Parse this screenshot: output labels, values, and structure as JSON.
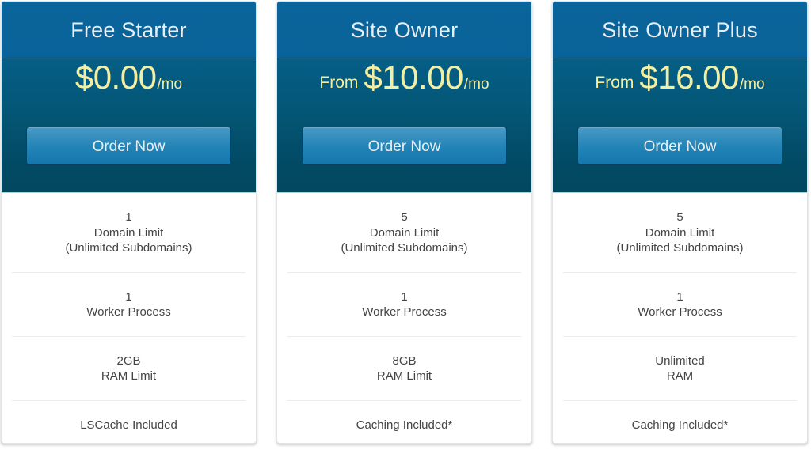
{
  "plans": [
    {
      "name": "Free Starter",
      "price_prefix": "",
      "price_amount": "$0.00",
      "price_period": "/mo",
      "cta_label": "Order Now",
      "features": [
        [
          "1",
          "Domain Limit",
          "(Unlimited Subdomains)"
        ],
        [
          "1",
          "Worker Process"
        ],
        [
          "2GB",
          "RAM Limit"
        ],
        [
          "LSCache Included"
        ]
      ]
    },
    {
      "name": "Site Owner",
      "price_prefix": "From",
      "price_amount": "$10.00",
      "price_period": "/mo",
      "cta_label": "Order Now",
      "features": [
        [
          "5",
          "Domain Limit",
          "(Unlimited Subdomains)"
        ],
        [
          "1",
          "Worker Process"
        ],
        [
          "8GB",
          "RAM Limit"
        ],
        [
          "Caching Included*"
        ]
      ]
    },
    {
      "name": "Site Owner Plus",
      "price_prefix": "From",
      "price_amount": "$16.00",
      "price_period": "/mo",
      "cta_label": "Order Now",
      "features": [
        [
          "5",
          "Domain Limit",
          "(Unlimited Subdomains)"
        ],
        [
          "1",
          "Worker Process"
        ],
        [
          "Unlimited",
          "RAM"
        ],
        [
          "Caching Included*"
        ]
      ]
    }
  ],
  "colors": {
    "header_top": "#0a659b",
    "header_bottom": "#01485f",
    "price_yellow": "#f3efa2",
    "button_top": "#4a9ac4",
    "button_bottom": "#1476ab",
    "feature_text": "#444444",
    "divider": "#ececec"
  }
}
